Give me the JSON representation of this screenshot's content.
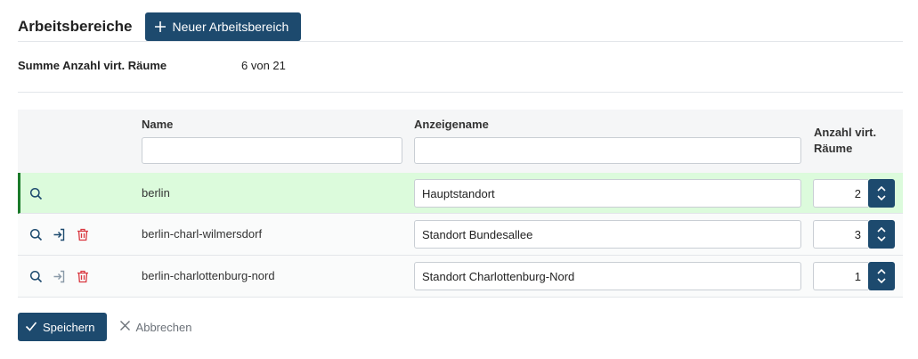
{
  "header": {
    "title": "Arbeitsbereiche",
    "new_button_label": "Neuer Arbeitsbereich"
  },
  "summary": {
    "label": "Summe Anzahl virt. Räume",
    "value": "6 von 21"
  },
  "table": {
    "columns": {
      "name": "Name",
      "display_name": "Anzeigename",
      "rooms_line1": "Anzahl virt.",
      "rooms_line2": "Räume"
    },
    "filters": {
      "name": "",
      "display_name": ""
    },
    "rows": [
      {
        "name": "berlin",
        "display_name": "Hauptstandort",
        "rooms": "2",
        "active": true
      },
      {
        "name": "berlin-charl-wilmersdorf",
        "display_name": "Standort Bundesallee",
        "rooms": "3",
        "active": false
      },
      {
        "name": "berlin-charlottenburg-nord",
        "display_name": "Standort Charlottenburg-Nord",
        "rooms": "1",
        "active": false
      }
    ]
  },
  "footer": {
    "save_label": "Speichern",
    "cancel_label": "Abbrechen"
  },
  "icons": {
    "plus": "plus-icon",
    "search": "search-icon",
    "enter": "enter-icon",
    "delete": "trash-icon",
    "up": "chevron-up-icon",
    "down": "chevron-down-icon",
    "check": "check-icon",
    "close": "close-icon"
  },
  "colors": {
    "primary": "#1d4a6e",
    "active_row_bg": "#dcfbdc",
    "active_row_border": "#1b7a2a",
    "delete": "#d9363e",
    "icon": "#1d4a6e",
    "icon_muted": "#8a9aa8"
  }
}
